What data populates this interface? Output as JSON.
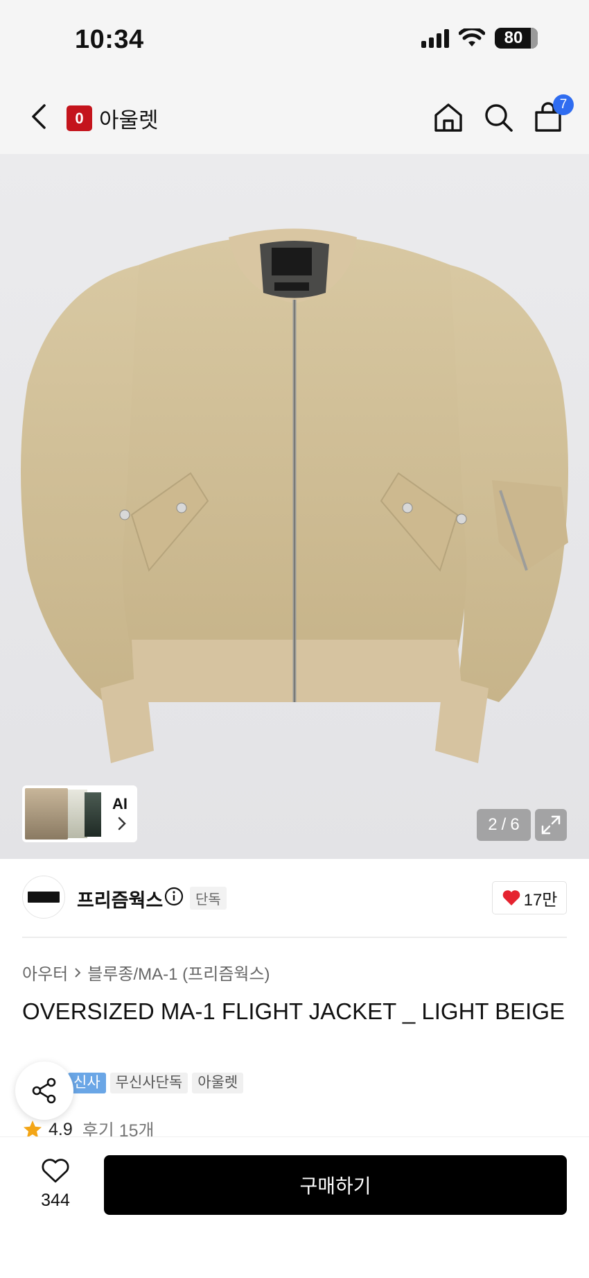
{
  "status_bar": {
    "time": "10:34",
    "battery": "80"
  },
  "nav": {
    "brand_logo_letter": "0",
    "brand_name": "아울렛",
    "cart_count": "7"
  },
  "hero": {
    "ai_label": "AI",
    "counter_current": "2",
    "counter_sep": "/",
    "counter_total": "6"
  },
  "brand": {
    "name": "프리즘웍스",
    "exclusive_tag": "단독",
    "likes": "17만"
  },
  "product": {
    "breadcrumb": [
      "아우터",
      "블루종/MA-1 (프리즘웍스)"
    ],
    "title": "OVERSIZED MA-1 FLIGHT JACKET _ LIGHT BEIGE",
    "tags": [
      "신사",
      "무신사단독",
      "아울렛"
    ],
    "rating": "4.9",
    "review_text": "후기 15개"
  },
  "bottom": {
    "wish_count": "344",
    "buy_label": "구매하기"
  },
  "colors": {
    "accent_red": "#c4141c",
    "badge_blue": "#2f6cf0",
    "heart_red": "#e5232f",
    "star": "#f3a516"
  }
}
